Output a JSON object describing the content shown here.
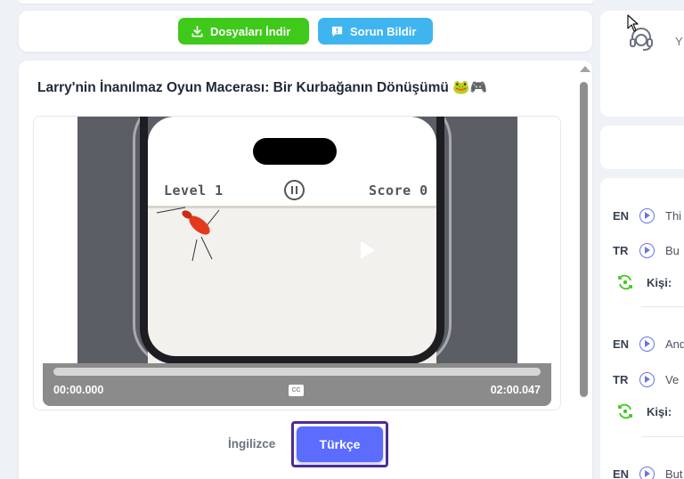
{
  "toolbar": {
    "download_label": "Dosyaları İndir",
    "report_label": "Sorun Bildir",
    "colors": {
      "download": "#3fc91a",
      "report": "#3fb5ef"
    }
  },
  "video": {
    "title": "Larry'nin İnanılmaz Oyun Macerası: Bir Kurbağanın Dönüşümü 🐸🎮",
    "game_level": "Level 1",
    "game_score": "Score 0",
    "current_time": "00:00.000",
    "duration": "02:00.047",
    "progress": 0,
    "cc_label": "CC"
  },
  "languages": {
    "options": [
      "İngilizce",
      "Türkçe"
    ],
    "selected": "Türkçe",
    "accent": "#5b6cff"
  },
  "support": {
    "icon": "headset-icon",
    "peek_text": "Y"
  },
  "transcript": {
    "kisi_label": "Kişi:",
    "rows": [
      {
        "en_code": "EN",
        "en_text": "Thi",
        "tr_code": "TR",
        "tr_text": "Bu"
      },
      {
        "en_code": "EN",
        "en_text": "And",
        "tr_code": "TR",
        "tr_text": "Ve"
      },
      {
        "en_code": "EN",
        "en_text": "But"
      }
    ]
  }
}
